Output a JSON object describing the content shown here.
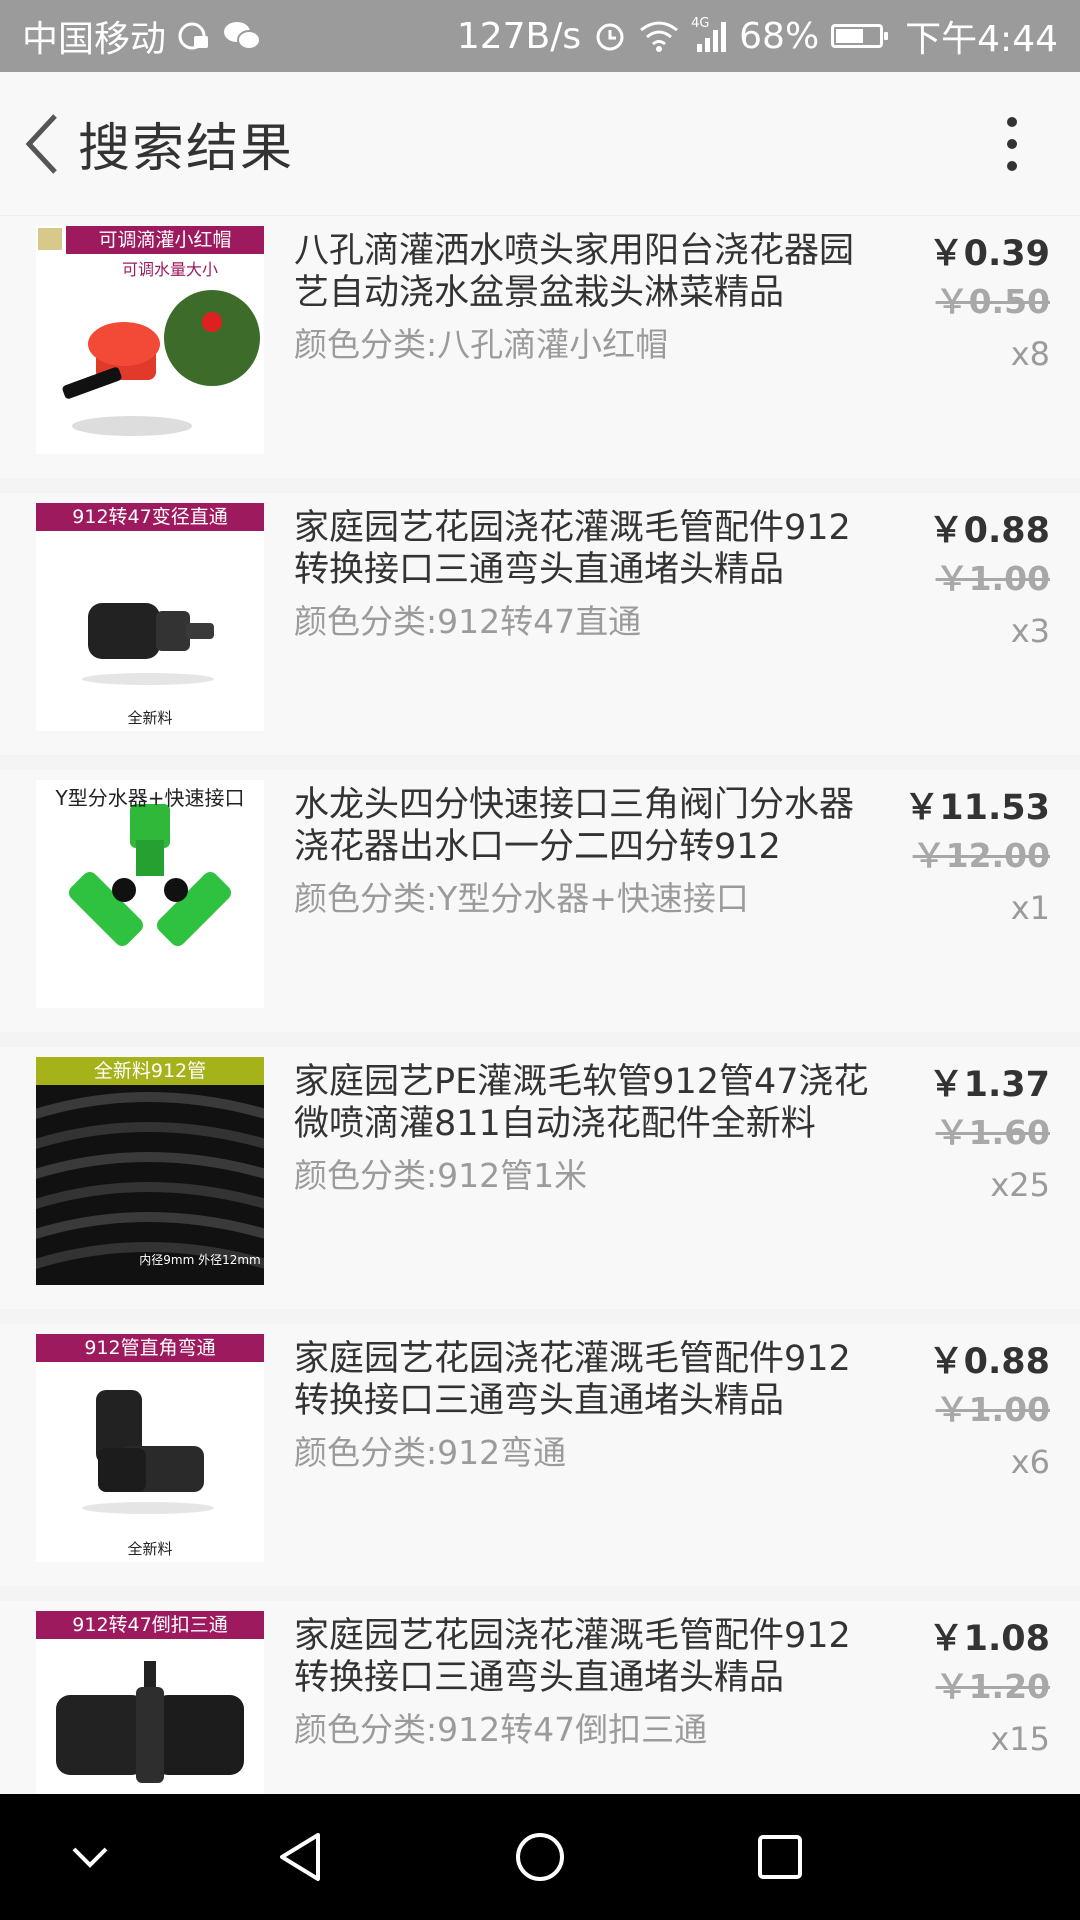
{
  "status_bar": {
    "carrier": "中国移动",
    "speed": "127B/s",
    "network": "4G",
    "battery": "68%",
    "battery_level": 0.68,
    "time": "下午4:44",
    "icons": [
      "data-saver-icon",
      "wechat-icon",
      "alarm-icon",
      "wifi-icon",
      "signal-icon",
      "battery-icon"
    ]
  },
  "header": {
    "title": "搜索结果",
    "back_icon": "chevron-left-icon",
    "more_icon": "more-vertical-icon"
  },
  "items": [
    {
      "thumb_label": "可调滴灌小红帽",
      "thumb_sublabel": "可调水量大小",
      "title": "八孔滴灌洒水喷头家用阳台浇花器园艺自动浇水盆景盆栽头淋菜精品",
      "sku": "颜色分类:八孔滴灌小红帽",
      "price": "￥0.39",
      "original_price": "￥0.50",
      "quantity": "x8"
    },
    {
      "thumb_label": "912转47变径直通",
      "thumb_sublabel": "全新料",
      "title": "家庭园艺花园浇花灌溉毛管配件912转换接口三通弯头直通堵头精品",
      "sku": "颜色分类:912转47直通",
      "price": "￥0.88",
      "original_price": "￥1.00",
      "quantity": "x3"
    },
    {
      "thumb_label": "Y型分水器+快速接口",
      "thumb_sublabel": "",
      "title": "水龙头四分快速接口三角阀门分水器浇花器出水口一分二四分转912",
      "sku": "颜色分类:Y型分水器+快速接口",
      "price": "￥11.53",
      "original_price": "￥12.00",
      "quantity": "x1"
    },
    {
      "thumb_label": "全新料912管",
      "thumb_sublabel": "内径9mm 外径12mm",
      "title": "家庭园艺PE灌溉毛软管912管47浇花微喷滴灌811自动浇花配件全新料",
      "sku": "颜色分类:912管1米",
      "price": "￥1.37",
      "original_price": "￥1.60",
      "quantity": "x25"
    },
    {
      "thumb_label": "912管直角弯通",
      "thumb_sublabel": "全新料",
      "title": "家庭园艺花园浇花灌溉毛管配件912转换接口三通弯头直通堵头精品",
      "sku": "颜色分类:912弯通",
      "price": "￥0.88",
      "original_price": "￥1.00",
      "quantity": "x6"
    },
    {
      "thumb_label": "912转47倒扣三通",
      "thumb_sublabel": "",
      "title": "家庭园艺花园浇花灌溉毛管配件912转换接口三通弯头直通堵头精品",
      "sku": "颜色分类:912转47倒扣三通",
      "price": "￥1.08",
      "original_price": "￥1.20",
      "quantity": "x15"
    }
  ],
  "nav_bar": {
    "icons": [
      "chevron-down-icon",
      "back-triangle-icon",
      "home-circle-icon",
      "recents-square-icon"
    ]
  },
  "colors": {
    "status_bar_bg": "#9b9b9b",
    "label_magenta": "#9e1a5e",
    "label_olive": "#a5b21a",
    "text_primary": "#333333",
    "text_secondary": "#9b9b9b"
  }
}
